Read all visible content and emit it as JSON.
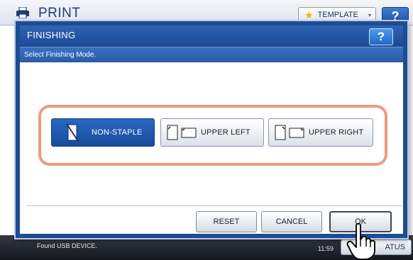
{
  "background": {
    "title": "PRINT",
    "template_button": "TEMPLATE",
    "help_label": "?",
    "footer_message": "Found USB DEVICE.",
    "footer_time": "11:59",
    "status_button": "ATUS"
  },
  "dialog": {
    "title": "FINISHING",
    "help_label": "?",
    "instruction": "Select Finishing Mode.",
    "options": [
      {
        "label": "NON-STAPLE",
        "icon": "non-staple-icon",
        "selected": true
      },
      {
        "label": "UPPER LEFT",
        "icon": "upper-left-staple-icon",
        "selected": false
      },
      {
        "label": "UPPER RIGHT",
        "icon": "upper-right-staple-icon",
        "selected": false
      }
    ],
    "buttons": {
      "reset": "RESET",
      "cancel": "CANCEL",
      "ok": "OK"
    }
  },
  "colors": {
    "dialog_border": "#1e4c92",
    "selected_option": "#1f5bb0",
    "highlight_frame": "#ee9a7e"
  }
}
